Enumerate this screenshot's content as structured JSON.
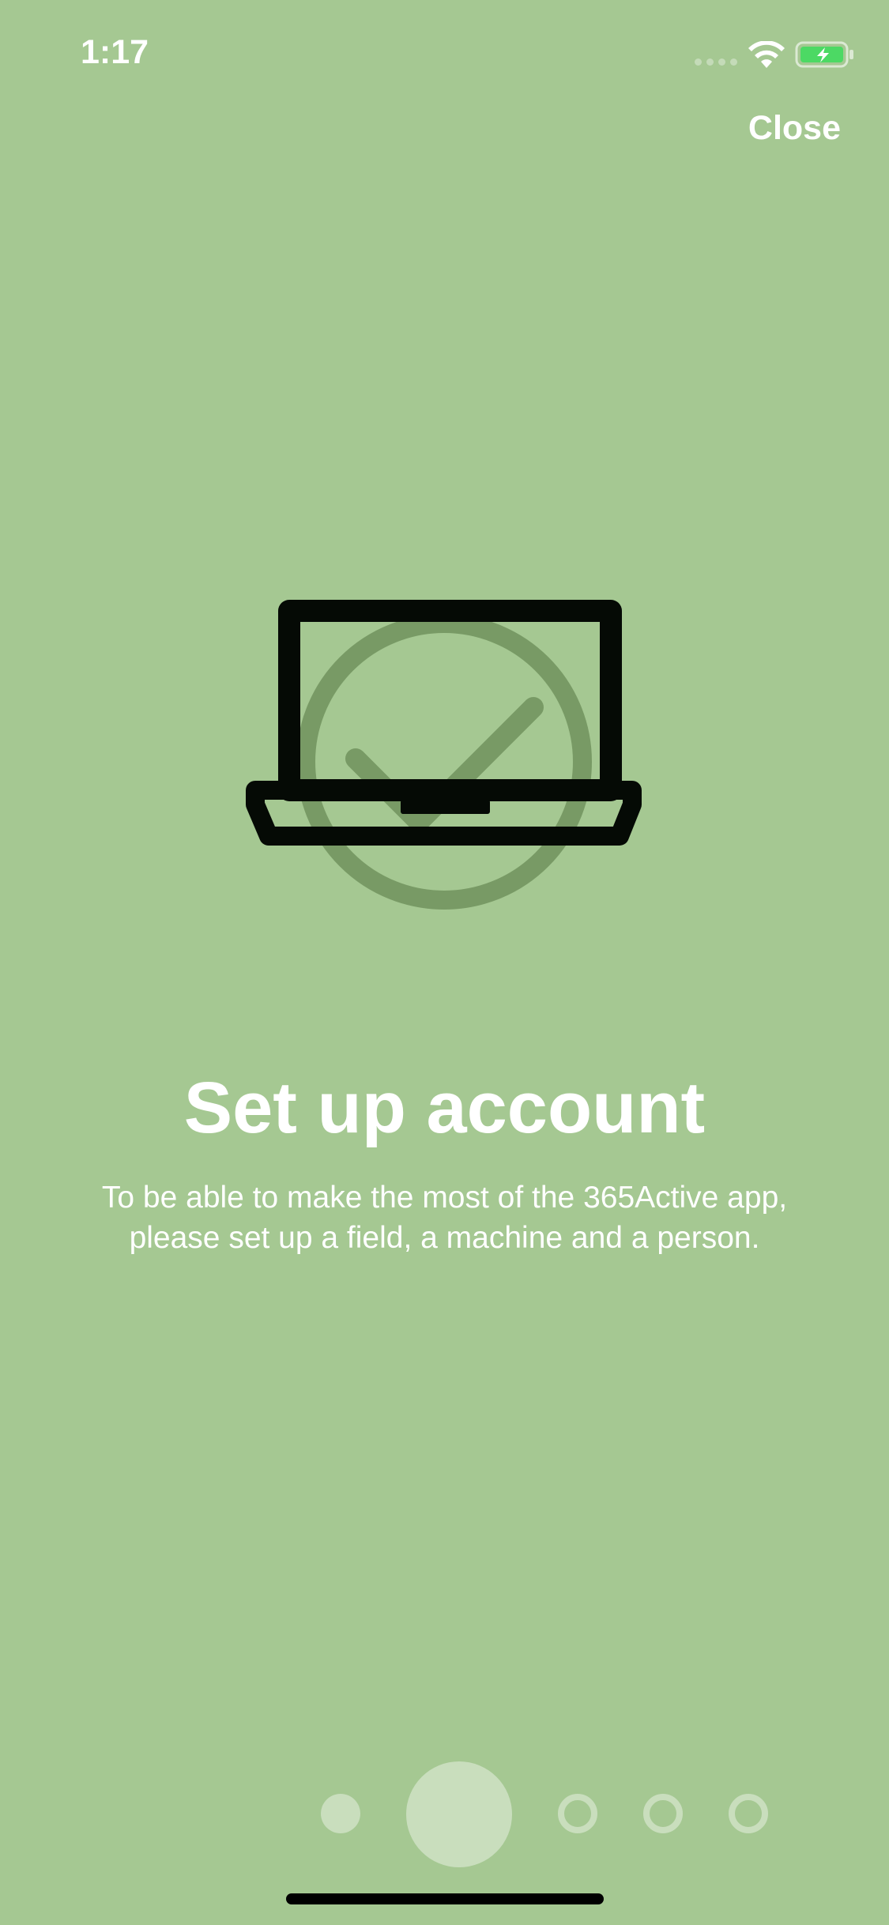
{
  "status_bar": {
    "time": "1:17",
    "icons": [
      "cellular-signal-icon",
      "wifi-icon",
      "battery-charging-icon"
    ]
  },
  "header": {
    "close_label": "Close"
  },
  "illustration": {
    "icon": "laptop-checkmark-icon"
  },
  "main": {
    "title": "Set up account",
    "description": "To be able to make the most of the 365Active app, please set up a field, a machine and a person."
  },
  "pager": {
    "page_count": 5,
    "current_page": 2
  },
  "colors": {
    "background": "#a5c892",
    "text": "#ffffff",
    "checkmark": "#789a65",
    "laptop_outline": "#050a05",
    "battery": "#4cd964"
  }
}
